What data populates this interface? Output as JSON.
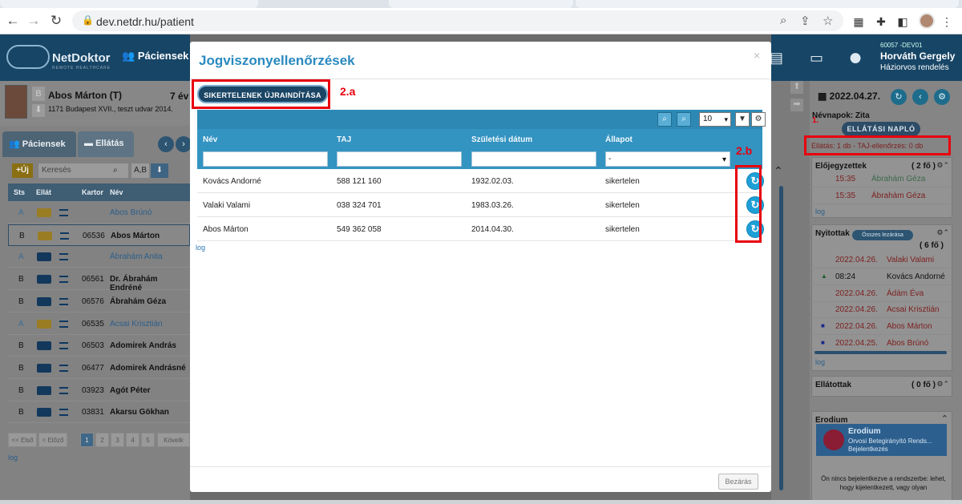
{
  "browser": {
    "url": "dev.netdr.hu/patient",
    "back_icon": "arrow-left",
    "forward_icon": "arrow-right",
    "reload_icon": "reload"
  },
  "app": {
    "logo_name": "NetDoktor",
    "logo_sub": "REMOTE HEALTHCARE",
    "header_menu": "Páciensek",
    "user": {
      "code": "60057 -DEV01",
      "name": "Horváth Gergely",
      "role": "Háziorvos rendelés"
    }
  },
  "patient": {
    "name": "Abos Márton (T)",
    "address": "1171 Budapest XVII., teszt udvar 2014.",
    "age": "7 év"
  },
  "left": {
    "tabs": [
      "Páciensek",
      "Ellátás"
    ],
    "new_label": "+Új",
    "search_placeholder": "Keresés",
    "sort_label": "A,B",
    "columns": [
      "Sts",
      "Ellát",
      "Kartor",
      "Név"
    ],
    "rows": [
      {
        "sts": "A",
        "kart": "",
        "nev": "Abos Brúnó",
        "style": "link",
        "folder": "yellow"
      },
      {
        "sts": "B",
        "kart": "06536",
        "nev": "Abos Márton",
        "style": "bold",
        "folder": "yellow"
      },
      {
        "sts": "A",
        "kart": "",
        "nev": "Ábrahám Anita",
        "style": "link",
        "folder": "blue"
      },
      {
        "sts": "B",
        "kart": "06561",
        "nev": "Dr. Ábrahám Endréné",
        "style": "bold",
        "folder": "blue"
      },
      {
        "sts": "B",
        "kart": "06576",
        "nev": "Ábrahám Géza",
        "style": "bold",
        "folder": "blue"
      },
      {
        "sts": "A",
        "kart": "06535",
        "nev": "Acsai Krisztián",
        "style": "link",
        "folder": "yellow"
      },
      {
        "sts": "B",
        "kart": "06503",
        "nev": "Adomirek András",
        "style": "bold",
        "folder": "blue"
      },
      {
        "sts": "B",
        "kart": "06477",
        "nev": "Adomirek Andrásné",
        "style": "bold",
        "folder": "blue"
      },
      {
        "sts": "B",
        "kart": "03923",
        "nev": "Agót Péter",
        "style": "bold",
        "folder": "blue"
      },
      {
        "sts": "B",
        "kart": "03831",
        "nev": "Akarsu Gökhan",
        "style": "bold",
        "folder": "blue"
      }
    ],
    "pager": [
      "<< Első",
      "< Előző",
      "1",
      "2",
      "3",
      "4",
      "5",
      "Követk"
    ],
    "log": "log"
  },
  "right": {
    "date": "2022.04.27.",
    "nevnap": "Névnapok: Zita",
    "naplo_button": "ELLÁTÁSI NAPLÓ",
    "annotation_1": "1.",
    "ellatas_status": "Ellátás: 1 db - TAJ-ellenőrzés: 0 db",
    "elojegyzettek": {
      "title": "Előjegyzettek",
      "count": "( 2 fő )",
      "rows": [
        {
          "t": "15:35",
          "n": "Ábrahám Géza"
        },
        {
          "t": "15:35",
          "n": "Ábrahám Géza"
        }
      ],
      "log": "log"
    },
    "nyitottak": {
      "title": "Nyitottak",
      "button": "Összes lezárása",
      "count": "( 6 fő )",
      "rows": [
        {
          "d": "2022.04.26.",
          "n": "Valaki Valami",
          "mark": ""
        },
        {
          "d": "08:24",
          "n": "Kovács Andorné",
          "mark": "▲"
        },
        {
          "d": "2022.04.26.",
          "n": "Ádám Éva",
          "mark": ""
        },
        {
          "d": "2022.04.26.",
          "n": "Acsai Krisztián",
          "mark": ""
        },
        {
          "d": "2022.04.26.",
          "n": "Abos Márton",
          "mark": "■"
        },
        {
          "d": "2022.04.25.",
          "n": "Abos Brúnó",
          "mark": "■"
        }
      ],
      "log": "log"
    },
    "ellatottak": {
      "title": "Ellátottak",
      "count": "( 0 fő )"
    },
    "erodium": {
      "title": "Erodium",
      "name": "Erodium",
      "line1": "Orvosi Betegirányító Rends...",
      "line2": "Bejelentkezés",
      "note": "Ön nincs bejelentkezve a rendszerbe: lehet, hogy kijelentkezett, vagy olyan"
    }
  },
  "modal": {
    "title": "Jogviszonyellenőrzések",
    "close": "×",
    "restart_button": "SIKERTELENEK ÚJRAINDÍTÁSA",
    "annotation_2a": "2.a",
    "annotation_2b": "2.b",
    "page_size": "10",
    "columns": [
      "Név",
      "TAJ",
      "Születési dátum",
      "Állapot"
    ],
    "status_filter": "-",
    "rows": [
      {
        "nev": "Kovács Andorné",
        "taj": "588 121 160",
        "szul": "1932.02.03.",
        "allapot": "sikertelen"
      },
      {
        "nev": "Valaki Valami",
        "taj": "038 324 701",
        "szul": "1983.03.26.",
        "allapot": "sikertelen"
      },
      {
        "nev": "Abos Márton",
        "taj": "549 362 058",
        "szul": "2014.04.30.",
        "allapot": "sikertelen"
      }
    ],
    "log": "log",
    "footer_close": "Bezárás"
  }
}
